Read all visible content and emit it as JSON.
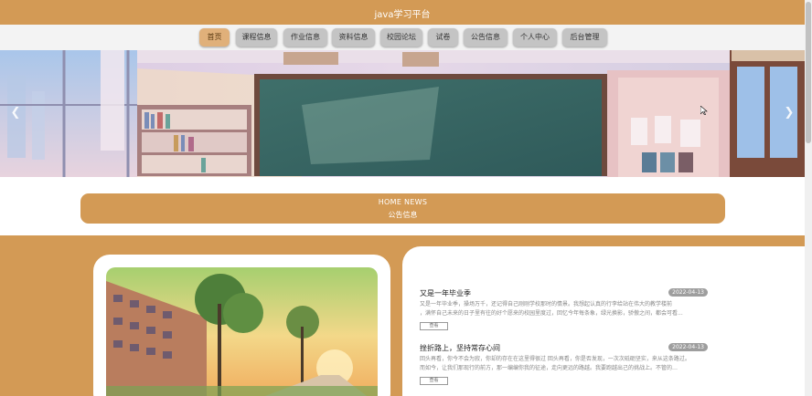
{
  "header": {
    "site_title": "java学习平台"
  },
  "nav": {
    "items": [
      {
        "label": "首页",
        "active": true
      },
      {
        "label": "课程信息"
      },
      {
        "label": "作业信息"
      },
      {
        "label": "资料信息"
      },
      {
        "label": "校园论坛"
      },
      {
        "label": "试卷"
      },
      {
        "label": "公告信息"
      },
      {
        "label": "个人中心"
      },
      {
        "label": "后台管理"
      }
    ]
  },
  "banner": {
    "prev_icon": "chevron-left-icon",
    "next_icon": "chevron-right-icon"
  },
  "news_header": {
    "title_en": "HOME NEWS",
    "title_cn": "公告信息"
  },
  "news": {
    "items": [
      {
        "title": "又是一年毕业季",
        "date": "2022-04-13",
        "summary_line1": "又是一年毕业季，操场万千，还记得自己刚刚学校那时的情景。我想起认真的行李给站在伟大的教学楼前",
        "summary_line2": "，满怀自己未来的日子里有往的好个愿来的校园里度过，回忆今年每条象，绿光换影，骄傲之间，都会可看...",
        "button": "查看"
      },
      {
        "title": "挫折路上，坚持常存心间",
        "date": "2022-04-13",
        "summary_line1": "回头再看，你今不会为寂，你却的存在在这里得很过 回头再看，你是否发现，一次次砥砺坚实，来从这条路过。",
        "summary_line2": "而如今，让我们那现行的前方，那一编编你我的征途，走向更远的路越。我要跑越出己的挑战上。不管的…",
        "button": "查看"
      }
    ]
  },
  "colors": {
    "brand": "#d39a55",
    "nav_bg": "#f3f3f3",
    "nav_button": "#c4c4c4",
    "nav_active": "#e0b07a",
    "date_badge": "#9e9e9e"
  }
}
